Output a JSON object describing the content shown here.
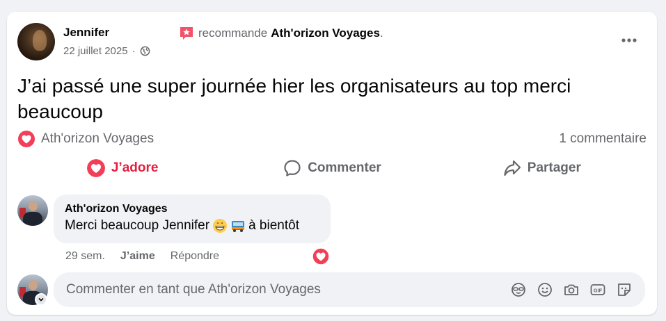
{
  "post": {
    "author": "Jennifer",
    "date": "22 juillet 2025",
    "date_sep": "·",
    "recommends_prefix": "recommande",
    "page_name": "Ath'orizon Voyages",
    "page_suffix": ".",
    "text": "J’ai passé une super journée hier les organisateurs au top merci beaucoup"
  },
  "reactions": {
    "reactor": "Ath'orizon Voyages",
    "comments_count": "1 commentaire"
  },
  "actions": {
    "adore": "J’adore",
    "comment": "Commenter",
    "share": "Partager"
  },
  "comment": {
    "author": "Ath'orizon Voyages",
    "text_before": "Merci beaucoup Jennifer",
    "text_after": "à bientôt",
    "time": "29 sem.",
    "like": "J’aime",
    "reply": "Répondre"
  },
  "input": {
    "placeholder": "Commenter en tant que Ath'orizon Voyages"
  },
  "colors": {
    "accent_red": "#e41e3f",
    "secondary_text": "#65676b"
  },
  "icons": [
    "globe-icon",
    "recommend-icon",
    "more-icon",
    "heart-icon",
    "comment-icon",
    "share-icon",
    "grin-emoji",
    "bus-emoji",
    "avatar-sticker-icon",
    "smiley-icon",
    "camera-icon",
    "gif-icon",
    "sticker-icon",
    "chevron-down-icon"
  ]
}
